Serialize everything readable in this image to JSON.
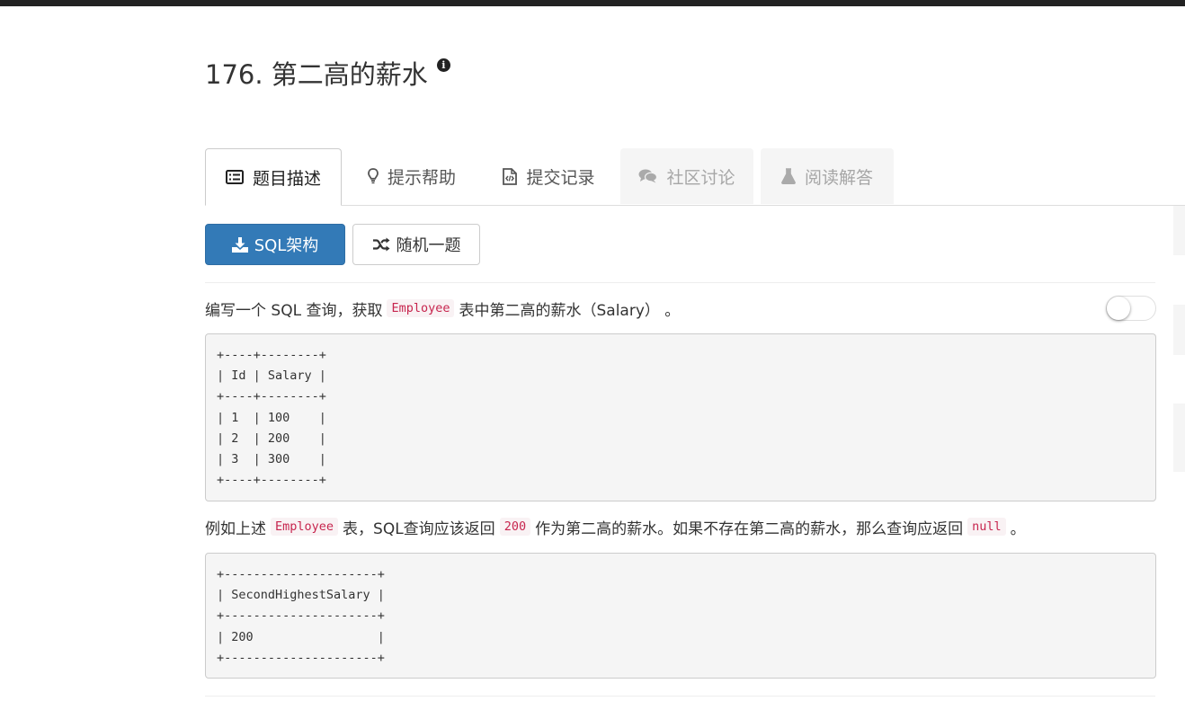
{
  "problem": {
    "title": "176. 第二高的薪水"
  },
  "tabs": [
    {
      "label": "题目描述",
      "icon": "list-icon",
      "state": "active"
    },
    {
      "label": "提示帮助",
      "icon": "lightbulb-icon",
      "state": "normal"
    },
    {
      "label": "提交记录",
      "icon": "code-file-icon",
      "state": "normal"
    },
    {
      "label": "社区讨论",
      "icon": "comments-icon",
      "state": "disabled"
    },
    {
      "label": "阅读解答",
      "icon": "flask-icon",
      "state": "disabled"
    }
  ],
  "buttons": {
    "sql_schema": "SQL架构",
    "random": "随机一题"
  },
  "description": {
    "p1_before": "编写一个 SQL 查询，获取",
    "p1_code": "Employee",
    "p1_after": "表中第二高的薪水（Salary） 。",
    "table1": "+----+--------+\n| Id | Salary |\n+----+--------+\n| 1  | 100    |\n| 2  | 200    |\n| 3  | 300    |\n+----+--------+",
    "p2_a": "例如上述",
    "p2_code1": "Employee",
    "p2_b": "表，SQL查询应该返回",
    "p2_code2": "200",
    "p2_c": "作为第二高的薪水。如果不存在第二高的薪水，那么查询应返回",
    "p2_code3": "null",
    "p2_d": "。",
    "table2": "+---------------------+\n| SecondHighestSalary |\n+---------------------+\n| 200                 |\n+---------------------+"
  },
  "toggle": {
    "on": false
  },
  "colors": {
    "primary": "#337ab7",
    "code_text": "#c7254e",
    "code_bg": "#f9f2f4"
  }
}
